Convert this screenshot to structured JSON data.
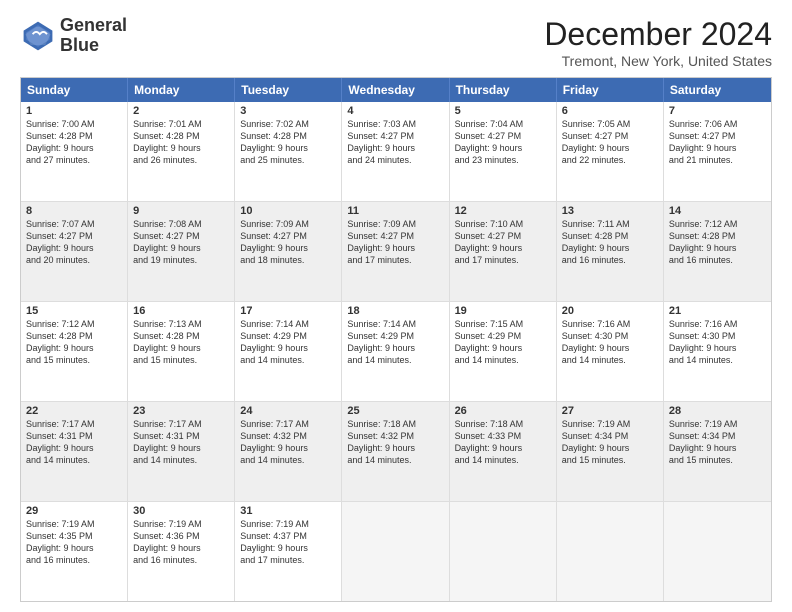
{
  "logo": {
    "line1": "General",
    "line2": "Blue"
  },
  "title": "December 2024",
  "subtitle": "Tremont, New York, United States",
  "header_days": [
    "Sunday",
    "Monday",
    "Tuesday",
    "Wednesday",
    "Thursday",
    "Friday",
    "Saturday"
  ],
  "weeks": [
    [
      {
        "day": "1",
        "info": "Sunrise: 7:00 AM\nSunset: 4:28 PM\nDaylight: 9 hours\nand 27 minutes.",
        "empty": false,
        "shaded": false
      },
      {
        "day": "2",
        "info": "Sunrise: 7:01 AM\nSunset: 4:28 PM\nDaylight: 9 hours\nand 26 minutes.",
        "empty": false,
        "shaded": false
      },
      {
        "day": "3",
        "info": "Sunrise: 7:02 AM\nSunset: 4:28 PM\nDaylight: 9 hours\nand 25 minutes.",
        "empty": false,
        "shaded": false
      },
      {
        "day": "4",
        "info": "Sunrise: 7:03 AM\nSunset: 4:27 PM\nDaylight: 9 hours\nand 24 minutes.",
        "empty": false,
        "shaded": false
      },
      {
        "day": "5",
        "info": "Sunrise: 7:04 AM\nSunset: 4:27 PM\nDaylight: 9 hours\nand 23 minutes.",
        "empty": false,
        "shaded": false
      },
      {
        "day": "6",
        "info": "Sunrise: 7:05 AM\nSunset: 4:27 PM\nDaylight: 9 hours\nand 22 minutes.",
        "empty": false,
        "shaded": false
      },
      {
        "day": "7",
        "info": "Sunrise: 7:06 AM\nSunset: 4:27 PM\nDaylight: 9 hours\nand 21 minutes.",
        "empty": false,
        "shaded": false
      }
    ],
    [
      {
        "day": "8",
        "info": "Sunrise: 7:07 AM\nSunset: 4:27 PM\nDaylight: 9 hours\nand 20 minutes.",
        "empty": false,
        "shaded": true
      },
      {
        "day": "9",
        "info": "Sunrise: 7:08 AM\nSunset: 4:27 PM\nDaylight: 9 hours\nand 19 minutes.",
        "empty": false,
        "shaded": true
      },
      {
        "day": "10",
        "info": "Sunrise: 7:09 AM\nSunset: 4:27 PM\nDaylight: 9 hours\nand 18 minutes.",
        "empty": false,
        "shaded": true
      },
      {
        "day": "11",
        "info": "Sunrise: 7:09 AM\nSunset: 4:27 PM\nDaylight: 9 hours\nand 17 minutes.",
        "empty": false,
        "shaded": true
      },
      {
        "day": "12",
        "info": "Sunrise: 7:10 AM\nSunset: 4:27 PM\nDaylight: 9 hours\nand 17 minutes.",
        "empty": false,
        "shaded": true
      },
      {
        "day": "13",
        "info": "Sunrise: 7:11 AM\nSunset: 4:28 PM\nDaylight: 9 hours\nand 16 minutes.",
        "empty": false,
        "shaded": true
      },
      {
        "day": "14",
        "info": "Sunrise: 7:12 AM\nSunset: 4:28 PM\nDaylight: 9 hours\nand 16 minutes.",
        "empty": false,
        "shaded": true
      }
    ],
    [
      {
        "day": "15",
        "info": "Sunrise: 7:12 AM\nSunset: 4:28 PM\nDaylight: 9 hours\nand 15 minutes.",
        "empty": false,
        "shaded": false
      },
      {
        "day": "16",
        "info": "Sunrise: 7:13 AM\nSunset: 4:28 PM\nDaylight: 9 hours\nand 15 minutes.",
        "empty": false,
        "shaded": false
      },
      {
        "day": "17",
        "info": "Sunrise: 7:14 AM\nSunset: 4:29 PM\nDaylight: 9 hours\nand 14 minutes.",
        "empty": false,
        "shaded": false
      },
      {
        "day": "18",
        "info": "Sunrise: 7:14 AM\nSunset: 4:29 PM\nDaylight: 9 hours\nand 14 minutes.",
        "empty": false,
        "shaded": false
      },
      {
        "day": "19",
        "info": "Sunrise: 7:15 AM\nSunset: 4:29 PM\nDaylight: 9 hours\nand 14 minutes.",
        "empty": false,
        "shaded": false
      },
      {
        "day": "20",
        "info": "Sunrise: 7:16 AM\nSunset: 4:30 PM\nDaylight: 9 hours\nand 14 minutes.",
        "empty": false,
        "shaded": false
      },
      {
        "day": "21",
        "info": "Sunrise: 7:16 AM\nSunset: 4:30 PM\nDaylight: 9 hours\nand 14 minutes.",
        "empty": false,
        "shaded": false
      }
    ],
    [
      {
        "day": "22",
        "info": "Sunrise: 7:17 AM\nSunset: 4:31 PM\nDaylight: 9 hours\nand 14 minutes.",
        "empty": false,
        "shaded": true
      },
      {
        "day": "23",
        "info": "Sunrise: 7:17 AM\nSunset: 4:31 PM\nDaylight: 9 hours\nand 14 minutes.",
        "empty": false,
        "shaded": true
      },
      {
        "day": "24",
        "info": "Sunrise: 7:17 AM\nSunset: 4:32 PM\nDaylight: 9 hours\nand 14 minutes.",
        "empty": false,
        "shaded": true
      },
      {
        "day": "25",
        "info": "Sunrise: 7:18 AM\nSunset: 4:32 PM\nDaylight: 9 hours\nand 14 minutes.",
        "empty": false,
        "shaded": true
      },
      {
        "day": "26",
        "info": "Sunrise: 7:18 AM\nSunset: 4:33 PM\nDaylight: 9 hours\nand 14 minutes.",
        "empty": false,
        "shaded": true
      },
      {
        "day": "27",
        "info": "Sunrise: 7:19 AM\nSunset: 4:34 PM\nDaylight: 9 hours\nand 15 minutes.",
        "empty": false,
        "shaded": true
      },
      {
        "day": "28",
        "info": "Sunrise: 7:19 AM\nSunset: 4:34 PM\nDaylight: 9 hours\nand 15 minutes.",
        "empty": false,
        "shaded": true
      }
    ],
    [
      {
        "day": "29",
        "info": "Sunrise: 7:19 AM\nSunset: 4:35 PM\nDaylight: 9 hours\nand 16 minutes.",
        "empty": false,
        "shaded": false
      },
      {
        "day": "30",
        "info": "Sunrise: 7:19 AM\nSunset: 4:36 PM\nDaylight: 9 hours\nand 16 minutes.",
        "empty": false,
        "shaded": false
      },
      {
        "day": "31",
        "info": "Sunrise: 7:19 AM\nSunset: 4:37 PM\nDaylight: 9 hours\nand 17 minutes.",
        "empty": false,
        "shaded": false
      },
      {
        "day": "",
        "info": "",
        "empty": true,
        "shaded": false
      },
      {
        "day": "",
        "info": "",
        "empty": true,
        "shaded": false
      },
      {
        "day": "",
        "info": "",
        "empty": true,
        "shaded": false
      },
      {
        "day": "",
        "info": "",
        "empty": true,
        "shaded": false
      }
    ]
  ]
}
